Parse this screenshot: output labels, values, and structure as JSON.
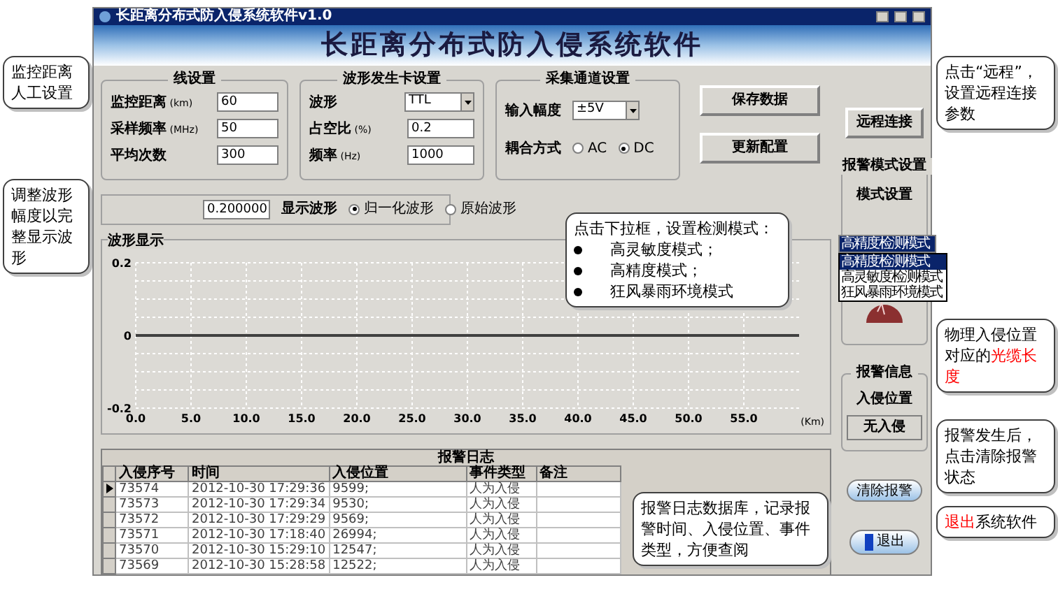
{
  "window": {
    "title": "长距离分布式防入侵系统软件v1.0",
    "header": "长距离分布式防入侵系统软件"
  },
  "line_group": {
    "title": "线设置",
    "fields": [
      {
        "label": "监控距离",
        "unit": "(km)",
        "value": "60"
      },
      {
        "label": "采样频率",
        "unit": "(MHz)",
        "value": "50"
      },
      {
        "label": "平均次数",
        "value": "300"
      }
    ]
  },
  "wave_group": {
    "title": "波形发生卡设置",
    "fields": [
      {
        "kind": "select",
        "label": "波形",
        "value": "TTL"
      },
      {
        "kind": "input",
        "label": "占空比",
        "unit": "(%)",
        "value": "0.2"
      },
      {
        "kind": "input",
        "label": "频率",
        "unit": "(Hz)",
        "value": "1000"
      }
    ]
  },
  "channel_group": {
    "title": "采集通道设置",
    "amplitude_label": "输入幅度",
    "amplitude_value": "±5V",
    "coupling_label": "耦合方式",
    "coupling": [
      {
        "label": "AC",
        "selected": false
      },
      {
        "label": "DC",
        "selected": true
      }
    ]
  },
  "buttons": [
    "保存数据",
    "更新配置"
  ],
  "display_row": {
    "amplitude_value": "0.200000",
    "label": "显示波形",
    "options": [
      {
        "label": "归一化波形",
        "selected": true
      },
      {
        "label": "原始波形",
        "selected": false
      }
    ]
  },
  "chart": {
    "title": "波形显示",
    "unit": "(Km)",
    "chart_data": {
      "type": "line",
      "x": [
        0,
        60
      ],
      "series": [
        {
          "color": "#404040",
          "values": [
            0,
            0
          ]
        }
      ],
      "grid": true,
      "xlim": [
        0,
        60
      ],
      "ylim": [
        -0.2,
        0.2
      ],
      "xticks": [
        {
          "value": 0,
          "label": "0.0"
        },
        {
          "value": 5,
          "label": "5.0"
        },
        {
          "value": 10,
          "label": "10.0"
        },
        {
          "value": 15,
          "label": "15.0"
        },
        {
          "value": 20,
          "label": "20.0"
        },
        {
          "value": 25,
          "label": "25.0"
        },
        {
          "value": 30,
          "label": "30.0"
        },
        {
          "value": 35,
          "label": "35.0"
        },
        {
          "value": 40,
          "label": "40.0"
        },
        {
          "value": 45,
          "label": "45.0"
        },
        {
          "value": 50,
          "label": "50.0"
        },
        {
          "value": 55,
          "label": "55.0"
        }
      ],
      "yticks": [
        {
          "value": -0.2,
          "label": "-0.2"
        },
        {
          "value": 0,
          "label": "0"
        },
        {
          "value": 0.2,
          "label": "0.2"
        }
      ]
    }
  },
  "log": {
    "title": "报警日志",
    "columns": [
      "入侵序号",
      "时间",
      "入侵位置",
      "事件类型",
      "备注"
    ],
    "rows": [
      {
        "cells": [
          "73574",
          "2012-10-30 17:29:36",
          "9599;",
          "人为入侵",
          ""
        ],
        "selected": true
      },
      {
        "cells": [
          "73573",
          "2012-10-30 17:29:34",
          "9530;",
          "人为入侵",
          ""
        ],
        "selected": false
      },
      {
        "cells": [
          "73572",
          "2012-10-30 17:29:29",
          "9569;",
          "人为入侵",
          ""
        ],
        "selected": false
      },
      {
        "cells": [
          "73571",
          "2012-10-30 17:18:40",
          "26994;",
          "人为入侵",
          ""
        ],
        "selected": false
      },
      {
        "cells": [
          "73570",
          "2012-10-30 15:29:10",
          "12547;",
          "人为入侵",
          ""
        ],
        "selected": false
      },
      {
        "cells": [
          "73569",
          "2012-10-30 15:28:58",
          "12522;",
          "人为入侵",
          ""
        ],
        "selected": false
      }
    ]
  },
  "side": {
    "remote_button": "远程连接",
    "mode_group": "报警模式设置",
    "mode_label": "模式设置",
    "mode_value": "高精度检测模式",
    "mode_options": [
      {
        "label": "高精度检测模式",
        "selected": true
      },
      {
        "label": "高灵敏度检测模式",
        "selected": false
      },
      {
        "label": "狂风暴雨环境模式",
        "selected": false
      }
    ],
    "alarm_group": "报警信息",
    "position_label": "入侵位置",
    "position_value": "无入侵",
    "clear_button": "清除报警",
    "exit_button": "退出"
  },
  "callouts": [
    {
      "kind": "plain",
      "text": "监控距离人工设置"
    },
    {
      "kind": "plain",
      "text": "调整波形幅度以完整显示波形"
    },
    {
      "kind": "plain",
      "text": "点击“远程”，设置远程连接参数"
    },
    {
      "kind": "list",
      "text": "点击下拉框，设置检测模式：",
      "items": [
        "高灵敏度模式；",
        "高精度模式；",
        "狂风暴雨环境模式"
      ]
    },
    {
      "kind": "highlight",
      "text": "物理入侵位置对应的",
      "highlight": "光缆长度"
    },
    {
      "kind": "plain",
      "text": "报警发生后，点击清除报警状态"
    },
    {
      "kind": "highlight_first",
      "text": "系统软件",
      "highlight": "退出"
    },
    {
      "kind": "plain",
      "text": "报警日志数据库，记录报警时间、入侵位置、事件类型，方便查阅"
    }
  ]
}
